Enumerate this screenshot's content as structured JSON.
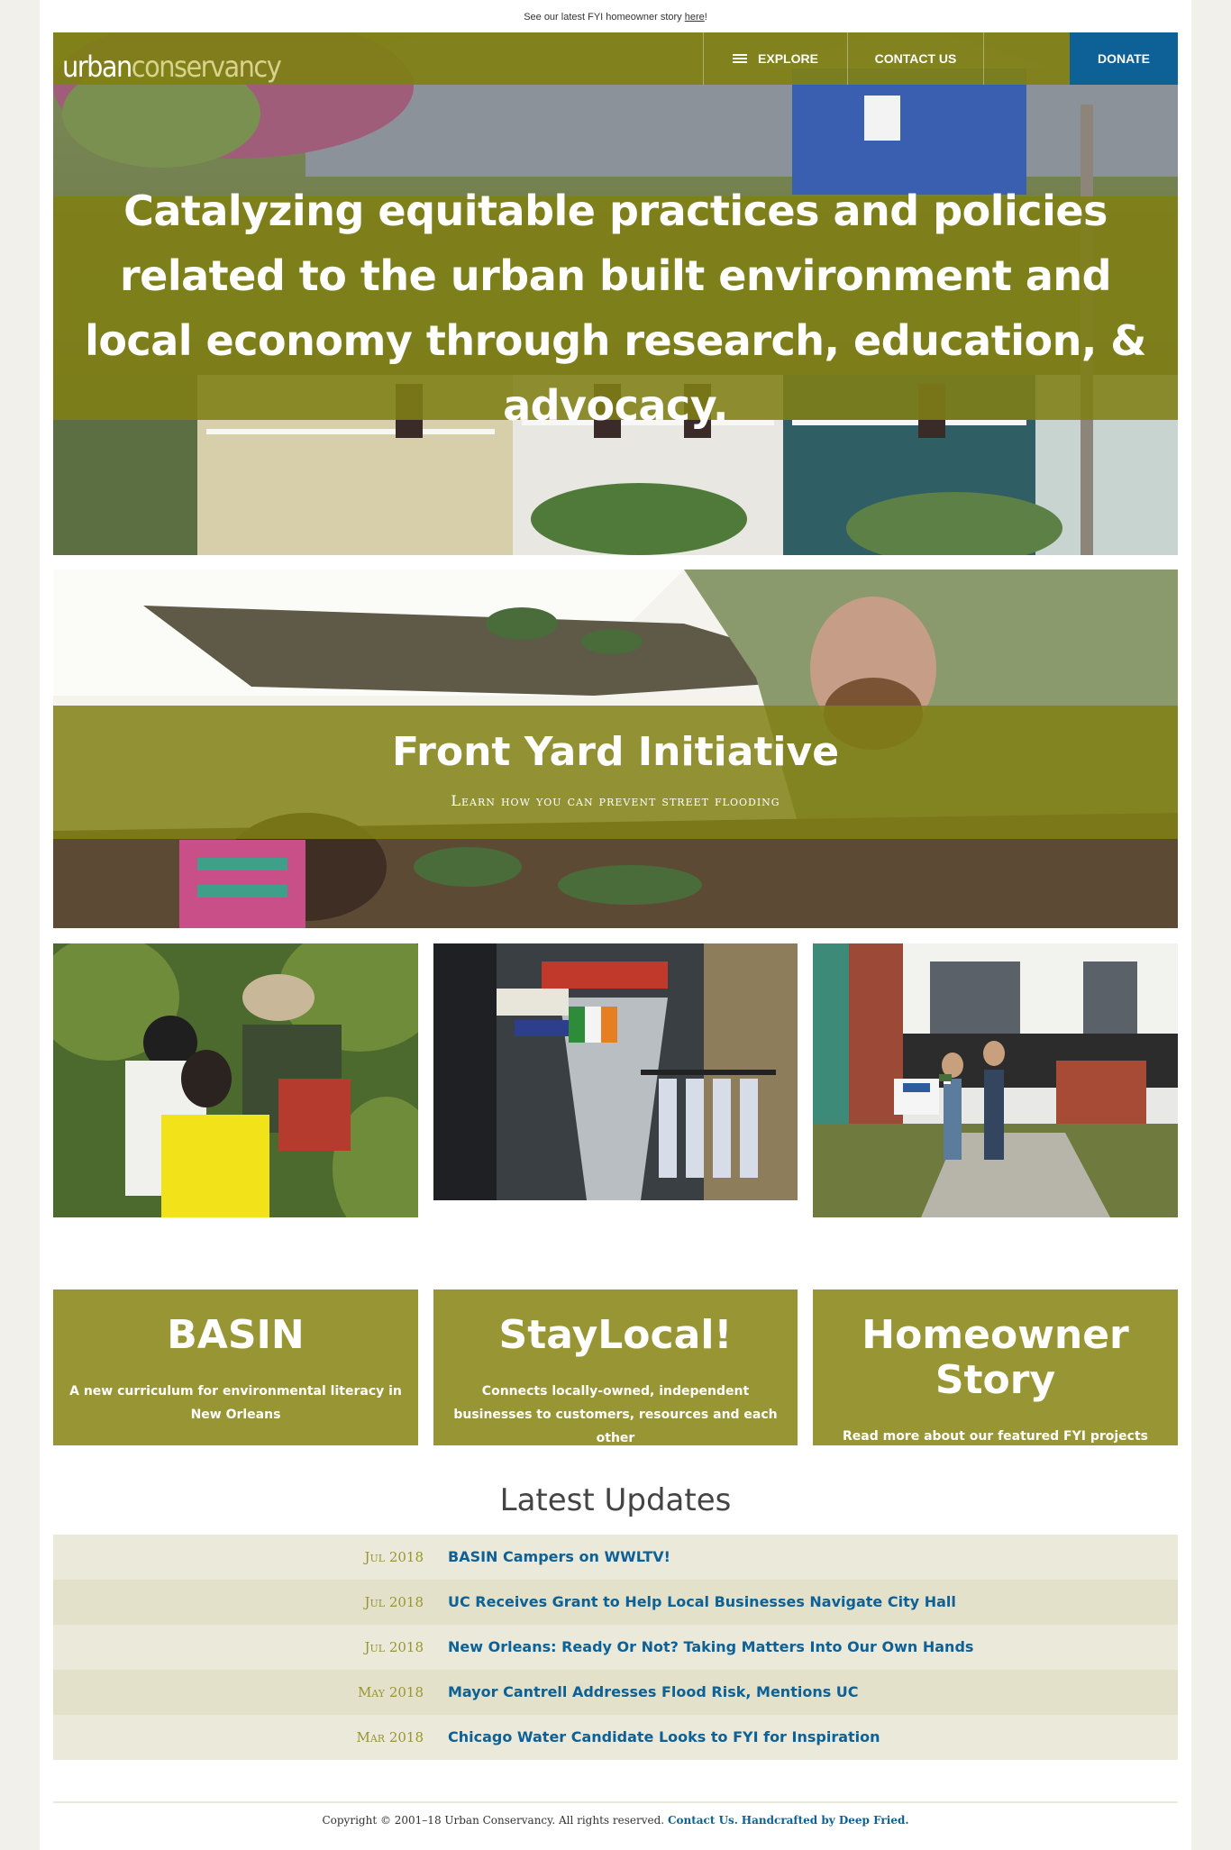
{
  "announcement": {
    "text": "See our latest FYI homeowner story",
    "link": "here",
    "suffix": "!"
  },
  "logo": {
    "part1": "urban",
    "part2": "conservancy"
  },
  "nav": {
    "explore": "EXPLORE",
    "contact": "CONTACT US",
    "donate": "DONATE"
  },
  "hero": {
    "headline": "Catalyzing equitable practices and policies related to the urban built environment and local economy through research, education, & advocacy."
  },
  "fyi": {
    "title": "Front Yard Initiative",
    "subtitle": "Learn how you can prevent street flooding"
  },
  "features": [
    {
      "title": "BASIN",
      "text": "A new curriculum for environmental literacy in New Orleans"
    },
    {
      "title": "StayLocal!",
      "text": "Connects locally-owned, independent businesses to customers, resources and each other"
    },
    {
      "title": "Homeowner Story",
      "text": "Read more about our featured FYI projects and get to know our homeowners!"
    }
  ],
  "updates": {
    "heading": "Latest Updates",
    "items": [
      {
        "date": "Jul 2018",
        "title": "BASIN Campers on WWLTV!"
      },
      {
        "date": "Jul 2018",
        "title": "UC Receives Grant to Help Local Businesses Navigate City Hall"
      },
      {
        "date": "Jul 2018",
        "title": "New Orleans: Ready Or Not? Taking Matters Into Our Own Hands"
      },
      {
        "date": "May 2018",
        "title": "Mayor Cantrell Addresses Flood Risk, Mentions UC"
      },
      {
        "date": "Mar 2018",
        "title": "Chicago Water Candidate Looks to FYI for Inspiration"
      }
    ]
  },
  "footer": {
    "copyright": "Copyright © 2001–18 Urban Conservancy. All rights reserved.",
    "contact": "Contact Us.",
    "credit": "Handcrafted by Deep Fried."
  },
  "colors": {
    "olive": "#989535",
    "olive_dark": "#80801a",
    "blue": "#0d6196"
  }
}
